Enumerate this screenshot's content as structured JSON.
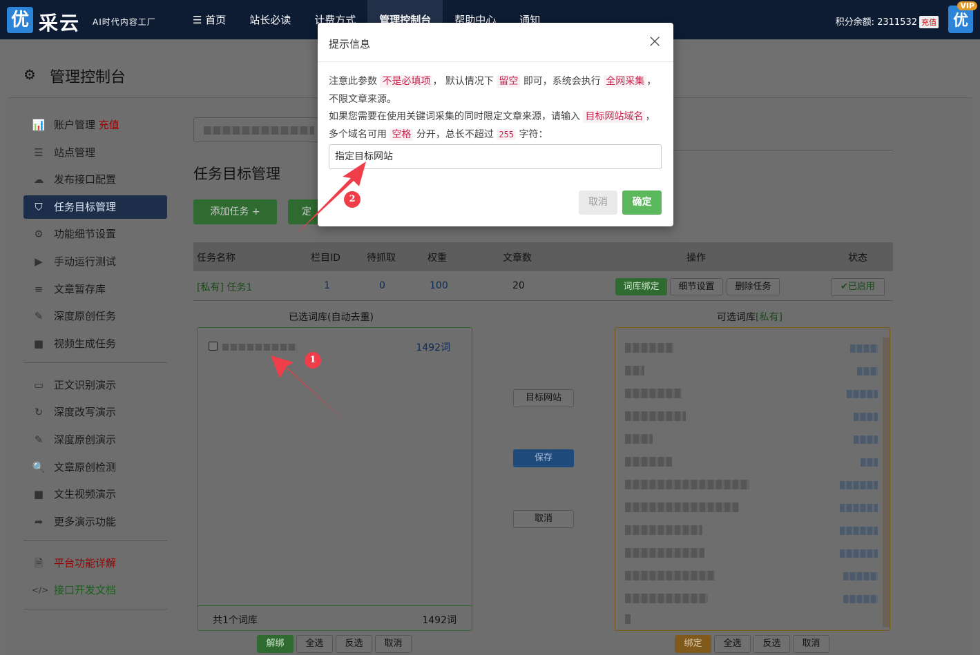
{
  "header": {
    "logo_char": "优",
    "brand": "采云",
    "slogan": "AI时代内容工厂",
    "nav": [
      {
        "label": "☰ 首页"
      },
      {
        "label": "站长必读"
      },
      {
        "label": "计费方式"
      },
      {
        "label": "管理控制台"
      },
      {
        "label": "帮助中心"
      },
      {
        "label": "通知"
      }
    ],
    "points_label": "积分余额: 2311532",
    "recharge_label": "充值",
    "vip_label": "VIP",
    "avatar_char": "优"
  },
  "page": {
    "title": "管理控制台"
  },
  "sidebar": {
    "group1": [
      {
        "label": "账户管理",
        "extra": "充值",
        "icon": "bar-chart-icon",
        "glyph": "📊"
      },
      {
        "label": "站点管理",
        "icon": "server-icon",
        "glyph": "☰"
      },
      {
        "label": "发布接口配置",
        "icon": "cloud-upload-icon",
        "glyph": "☁"
      },
      {
        "label": "任务目标管理",
        "icon": "filter-icon",
        "glyph": "⛉"
      },
      {
        "label": "功能细节设置",
        "icon": "cogs-icon",
        "glyph": "⚙"
      },
      {
        "label": "手动运行测试",
        "icon": "play-circle-icon",
        "glyph": "▶"
      },
      {
        "label": "文章暂存库",
        "icon": "database-icon",
        "glyph": "≡"
      },
      {
        "label": "深度原创任务",
        "icon": "edit-icon",
        "glyph": "✎"
      },
      {
        "label": "视频生成任务",
        "icon": "video-camera-icon",
        "glyph": "■"
      }
    ],
    "group2": [
      {
        "label": "正文识别演示",
        "icon": "monitor-icon",
        "glyph": "▭"
      },
      {
        "label": "深度改写演示",
        "icon": "refresh-icon",
        "glyph": "↻"
      },
      {
        "label": "深度原创演示",
        "icon": "edit-icon",
        "glyph": "✎"
      },
      {
        "label": "文章原创检测",
        "icon": "search-icon",
        "glyph": "🔍"
      },
      {
        "label": "文生视频演示",
        "icon": "video-camera-icon",
        "glyph": "■"
      },
      {
        "label": "更多演示功能",
        "icon": "share-icon",
        "glyph": "➦"
      }
    ],
    "group3": [
      {
        "label": "平台功能详解",
        "icon": "document-icon",
        "glyph": "🗎"
      },
      {
        "label": "接口开发文档",
        "icon": "code-icon",
        "glyph": "</>"
      }
    ]
  },
  "task_section": {
    "title": "任务目标管理",
    "add_label": "添加任务 +",
    "def_label": "定"
  },
  "table": {
    "headers": [
      "任务名称",
      "栏目ID",
      "待抓取",
      "权重",
      "文章数",
      "操作",
      "状态"
    ],
    "row": {
      "name": "[私有] 任务1",
      "column_id": "1",
      "pending": "0",
      "weight": "100",
      "articles": "20",
      "op_bind": "词库绑定",
      "op_detail": "细节设置",
      "op_delete": "删除任务",
      "status": "✔已启用"
    }
  },
  "libraries": {
    "selected_title": "已选词库(自动去重)",
    "selected_item_words": "1492词",
    "footer_count": "共1个词库",
    "footer_words": "1492词",
    "available_title_prefix": "可选词库",
    "available_title_tag": "[私有]"
  },
  "middle_buttons": {
    "target_site": "目标网站",
    "save": "保存",
    "cancel": "取消"
  },
  "bottom_left": {
    "unbind": "解绑",
    "select_all": "全选",
    "invert": "反选",
    "cancel": "取消"
  },
  "bottom_right": {
    "bind": "绑定",
    "select_all": "全选",
    "invert": "反选",
    "cancel": "取消"
  },
  "modal": {
    "title": "提示信息",
    "close": "×",
    "line1_a": "注意此参数",
    "line1_b": "不是必填项",
    "line1_c": "， 默认情况下",
    "line1_d": "留空",
    "line1_e": "即可，系统会执行",
    "line1_f": "全网采集",
    "line1_g": "， 不限文章来源。",
    "line2_a": "如果您需要在使用关键词采集的同时限定文章来源，请输入",
    "line2_b": "目标网站域名",
    "line2_c": "，多个域名可用",
    "line2_d": "空格",
    "line2_e": "分开，总长不超过",
    "line2_f": "255",
    "line2_g": "字符：",
    "input_value": "指定目标网站",
    "cancel_label": "取消",
    "ok_label": "确定"
  },
  "annotations": {
    "badge1": "1",
    "badge2": "2"
  },
  "colors": {
    "accent_green": "#5cb85c",
    "highlight_red": "#c7254e",
    "nav_bg": "#0d1b33"
  }
}
